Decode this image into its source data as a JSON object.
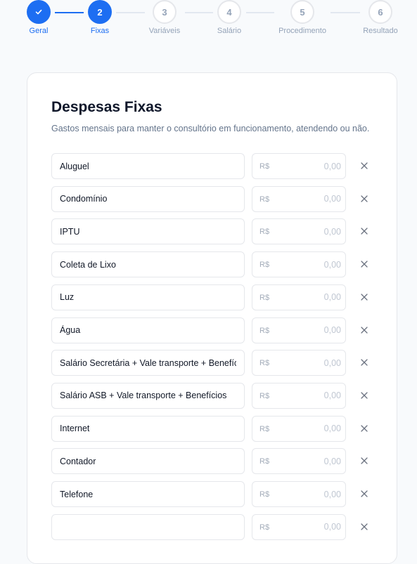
{
  "stepper": {
    "steps": [
      {
        "number": "",
        "label": "Geral",
        "state": "done"
      },
      {
        "number": "2",
        "label": "Fixas",
        "state": "active"
      },
      {
        "number": "3",
        "label": "Variáveis",
        "state": "pending"
      },
      {
        "number": "4",
        "label": "Salário",
        "state": "pending"
      },
      {
        "number": "5",
        "label": "Procedimento",
        "state": "pending"
      },
      {
        "number": "6",
        "label": "Resultado",
        "state": "pending"
      }
    ]
  },
  "card": {
    "title": "Despesas Fixas",
    "subtitle": "Gastos mensais para manter o consultório em funcionamento, atendendo ou não.",
    "currency_symbol": "R$",
    "items": [
      {
        "name": "Aluguel",
        "value": "0,00"
      },
      {
        "name": "Condomínio",
        "value": "0,00"
      },
      {
        "name": "IPTU",
        "value": "0,00"
      },
      {
        "name": "Coleta de Lixo",
        "value": "0,00"
      },
      {
        "name": "Luz",
        "value": "0,00"
      },
      {
        "name": "Água",
        "value": "0,00"
      },
      {
        "name": "Salário Secretária + Vale transporte + Benefícios",
        "value": "0,00"
      },
      {
        "name": "Salário ASB + Vale transporte + Benefícios",
        "value": "0,00"
      },
      {
        "name": "Internet",
        "value": "0,00"
      },
      {
        "name": "Contador",
        "value": "0,00"
      },
      {
        "name": "Telefone",
        "value": "0,00"
      },
      {
        "name": "",
        "value": "0,00"
      }
    ]
  },
  "colors": {
    "accent": "#1d6ef2",
    "muted": "#94a3b8"
  },
  "icons": {
    "done_step": "check-icon",
    "remove": "close-icon"
  }
}
